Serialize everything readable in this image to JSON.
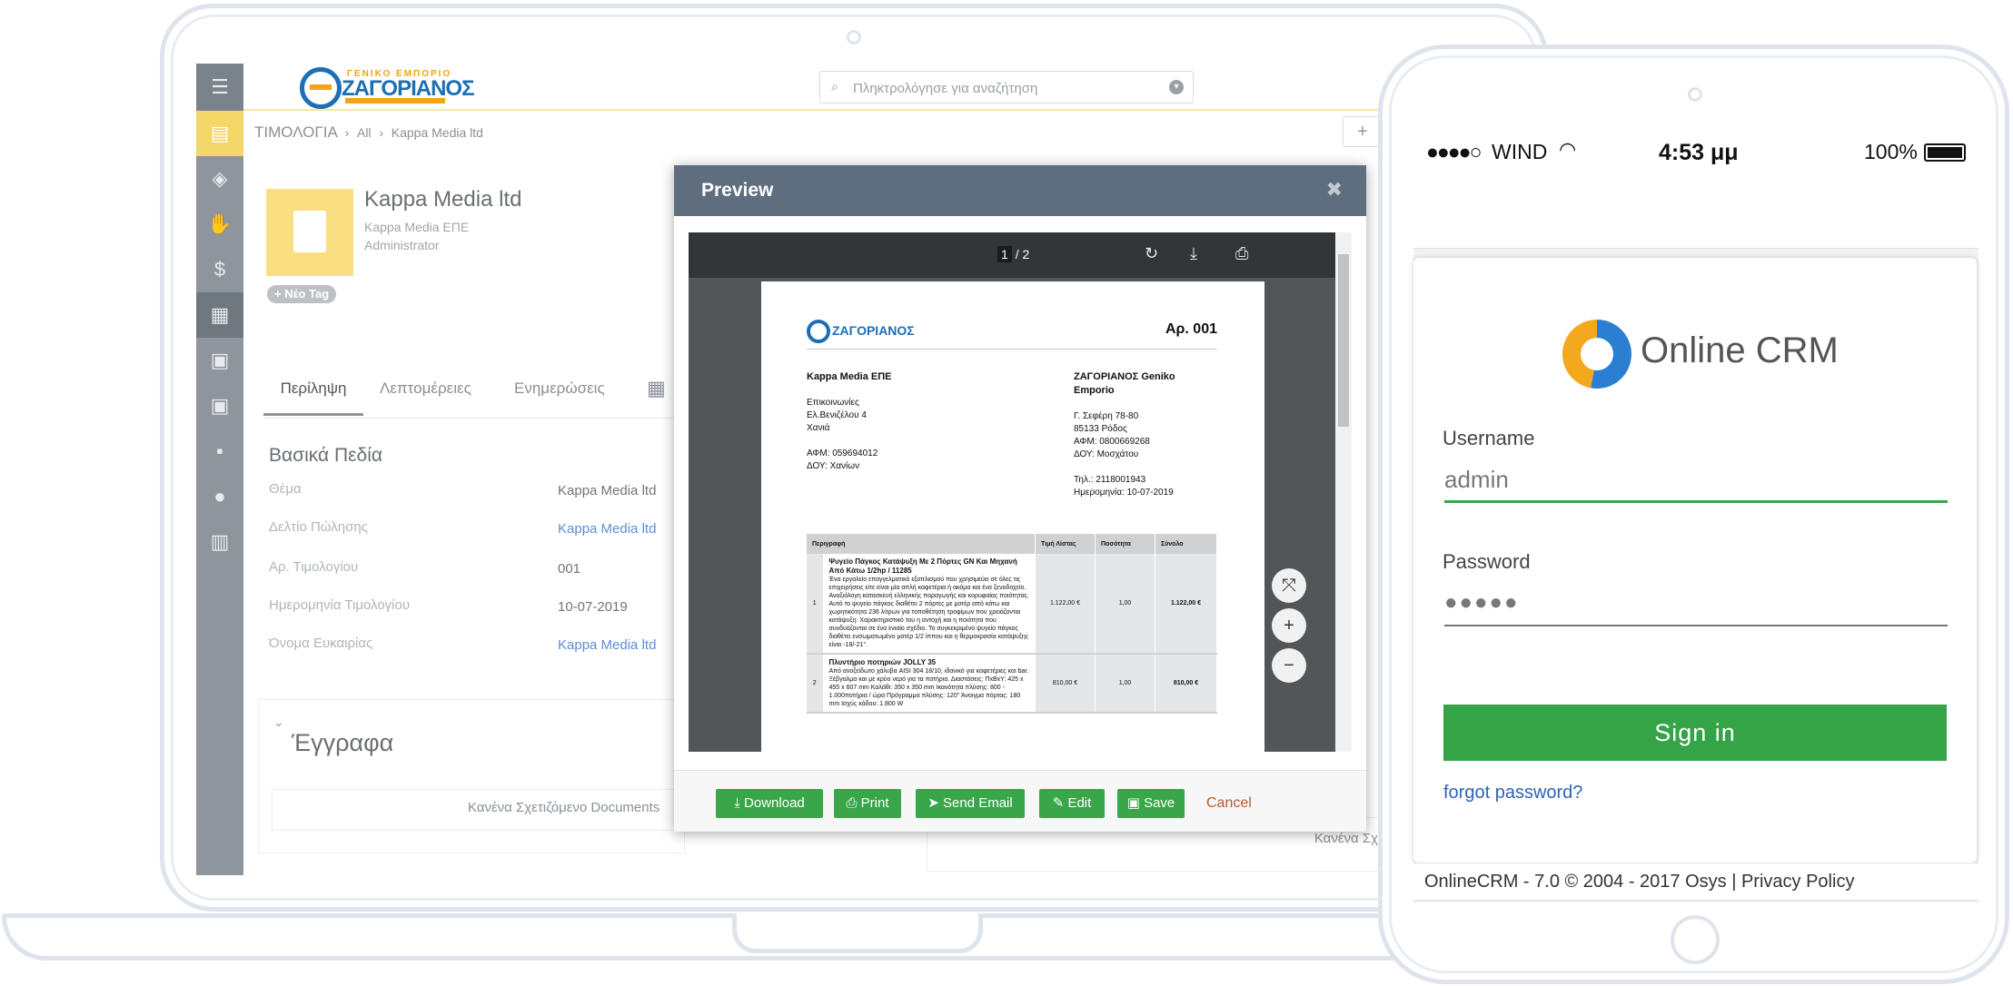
{
  "app": {
    "logo_top": "ΓΕΝΙΚΟ ΕΜΠΟΡΙΟ",
    "logo_main": "ΖΑΓΟΡΙΑΝΟΣ",
    "search_placeholder": "Πληκτρολόγησε για αναζήτηση",
    "breadcrumb": [
      "ΤΙΜΟΛΟΓΙΑ",
      "All",
      "Kappa Media ltd"
    ]
  },
  "sidebar": {
    "items": [
      "menu-icon",
      "invoices-icon",
      "box-icon",
      "handshake-icon",
      "dollar-icon",
      "invoice-icon",
      "so-icon",
      "po-icon",
      "contact-icon",
      "user-icon",
      "building-icon"
    ]
  },
  "record": {
    "title": "Kappa Media ltd",
    "company": "Kappa Media ΕΠΕ",
    "role": "Administrator",
    "new_tag": "+ Νέο Tag"
  },
  "tabs": [
    "Περίληψη",
    "Λεπτομέρειες",
    "Ενημερώσεις"
  ],
  "fields": {
    "section_title": "Βασικά Πεδία",
    "rows": [
      {
        "label": "Θέμα",
        "value": "Kappa Media ltd"
      },
      {
        "label": "Δελτίο Πώλησης",
        "value": "Kappa Media ltd"
      },
      {
        "label": "Αρ. Τιμολογίου",
        "value": "001"
      },
      {
        "label": "Ημερομηνία Τιμολογίου",
        "value": "10-07-2019"
      },
      {
        "label": "Όνομα Ευκαιρίας",
        "value": "Kappa Media ltd"
      }
    ]
  },
  "documents": {
    "title": "Έγγραφα",
    "empty": "Κανένα Σχετιζόμενο Documents",
    "right_empty": "Κανένα Σχ"
  },
  "preview": {
    "title": "Preview",
    "pager_current": "1",
    "pager_total": "/ 2",
    "buttons": {
      "download": "Download",
      "print": "Print",
      "send_email": "Send Email",
      "edit": "Edit",
      "save": "Save",
      "cancel": "Cancel"
    },
    "invoice": {
      "logo": "ΖΑΓΟΡΙΑΝΟΣ",
      "number": "Αρ. 001",
      "customer": {
        "name": "Kappa Media ΕΠΕ",
        "lines": [
          "Επικοινωνίες",
          "Ελ.Βενιζέλου 4",
          "Χανιά"
        ],
        "afm": "ΑΦΜ: 059694012",
        "doy": "ΔΟΥ: Χανίων"
      },
      "seller": {
        "name": "ΖΑΓΟΡΙΑΝΟΣ Geniko Emporio",
        "lines": [
          "Γ. Σεφέρη 78-80",
          "85133 Ρόδος",
          "ΑΦΜ: 0800669268",
          "ΔΟΥ: Μοσχάτου"
        ],
        "phone": "Τηλ.: 2118001943",
        "date": "Ημερομηνία: 10-07-2019"
      },
      "columns": [
        "Περιγραφή",
        "Τιμή Λίστας",
        "Ποσότητα",
        "Σύνολο"
      ],
      "items": [
        {
          "num": "1",
          "title": "Ψυγείο Πάγκος Κατάψυξη Με 2 Πόρτες GN Και Μηχανή Από Κάτω 1/2hp / 11285",
          "desc": "Ένα εργαλείο επαγγελματικό εξοπλισμού που χρησιμεύει σε όλες τις επιχειρήσεις είτε είναι μία απλή καφετέρια ή ακόμα και ένα ξενοδοχείο. Αναξιόλογη κατασκευή ελληνικής παραγωγής και κορυφαίας ποιότητας. Αυτό το ψυγείο πάγκος διαθέτει 2 πόρτες με μοτέρ από κάτω και χωρητικότητα 236 λίτρων για τοποθέτηση τροφίμων που χρειάζονται κατάψυξη. Χαρακτηριστικό του η αντοχή και η ποιότητα που συνδυάζονται σε ένα ενιαίο σχέδιο. Το συγκεκριμένο ψυγείο πάγκος διαθέτει ενσωματωμένο μοτέρ 1/2 ίππου και η θερμοκρασία κατάψυξης είναι -18/-21°.",
          "price": "1.122,00 €",
          "qty": "1,00",
          "total": "1.122,00 €"
        },
        {
          "num": "2",
          "title": "Πλυντήριο ποτηριών JOLLY 35",
          "desc": "Από ανοξείδωτο χάλυβα AISI 304 18/10, ιδανικό για καφετέριες και bar. Ξέβγαλμα και με κρύο νερό για τα ποτήρια. Διαστάσεις: ΠxΒxΥ: 425 x 455 x 607 mm Καλάθι: 350 x 350 mm Ικανότητα πλύσης: 800 - 1.000ποτήρια / ώρα Πρόγραμμα πλύσης: 120'' Άνοιγμα πόρτας: 180 mm Ισχύς κάδου: 1.800 W",
          "price": "810,00 €",
          "qty": "1,00",
          "total": "810,00 €"
        }
      ]
    }
  },
  "phone": {
    "status": {
      "carrier": "WIND",
      "time": "4:53 μμ",
      "battery": "100%"
    },
    "logo_text": "Online CRM",
    "username_label": "Username",
    "username_value": "admin",
    "password_label": "Password",
    "password_value": "●●●●●",
    "signin": "Sign in",
    "forgot": "forgot password?",
    "footer": "OnlineCRM - 7.0  © 2004 - 2017   Osys |  Privacy Policy"
  },
  "colors": {
    "accent_green": "#35a447",
    "sidebar": "#8e959c",
    "modal_header": "#5f6e7e",
    "logo_blue": "#1d6fb5",
    "logo_orange": "#f2a316"
  }
}
